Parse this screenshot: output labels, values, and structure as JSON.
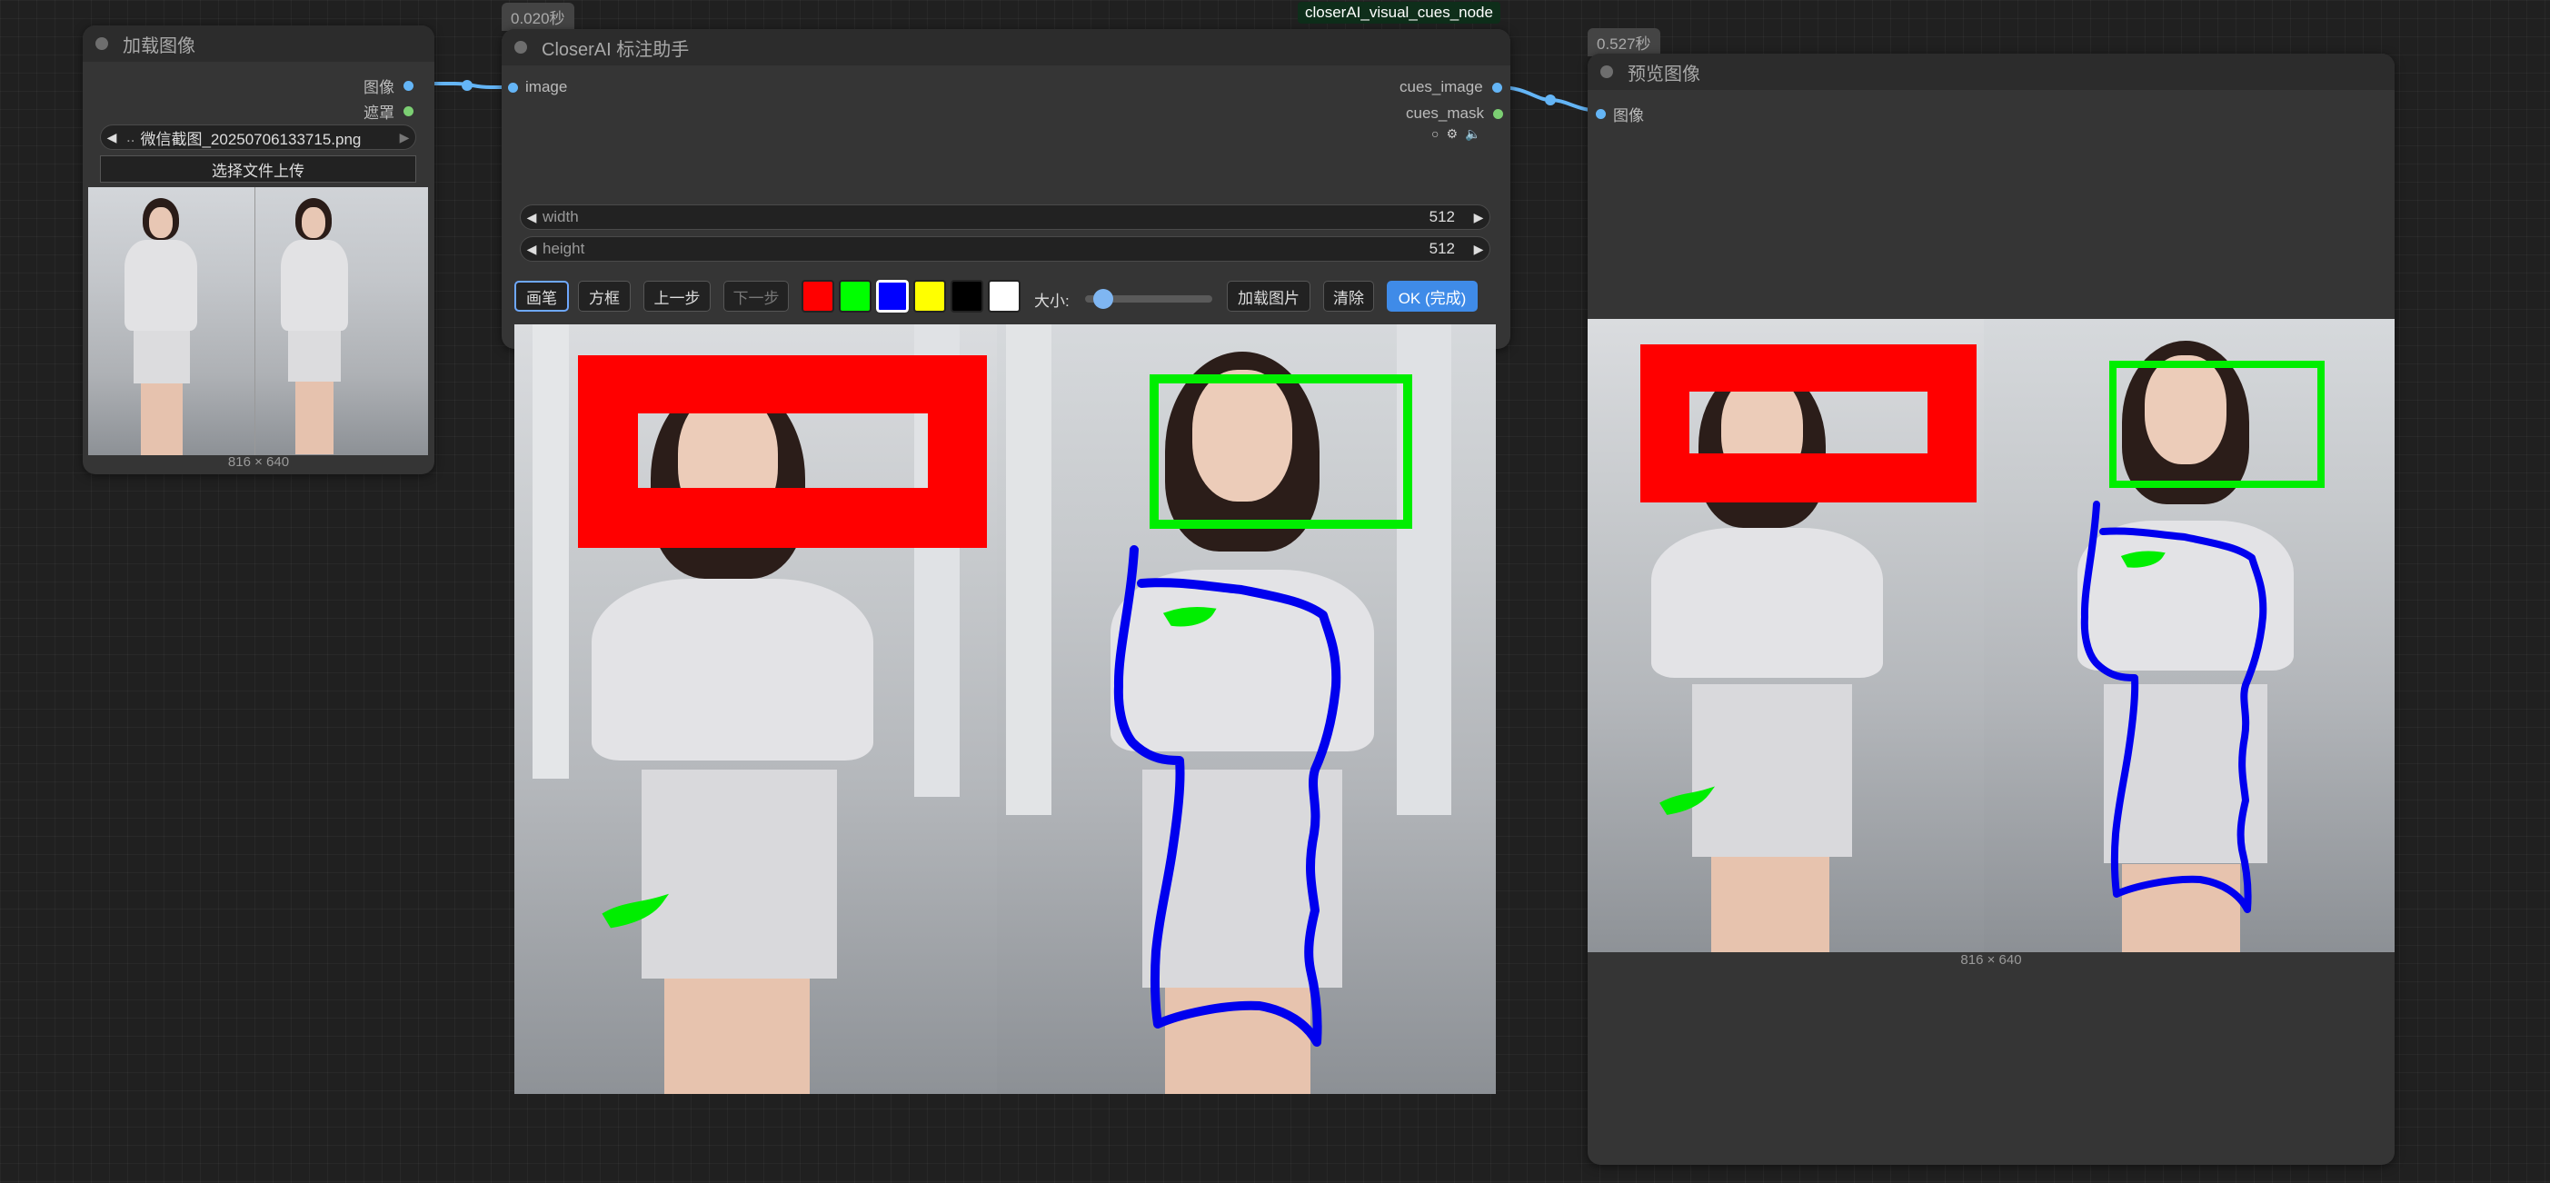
{
  "load_node": {
    "title": "加载图像",
    "outputs": [
      "图像",
      "遮罩"
    ],
    "file_value": "微信截图_20250706133715.png",
    "file_prefix": "..",
    "upload_label": "选择文件上传",
    "dims": "816 × 640"
  },
  "closer_node": {
    "timing": "0.020秒",
    "badge": "closerAI_visual_cues_node",
    "title": "CloserAI 标注助手",
    "input": "image",
    "outputs": [
      "cues_image",
      "cues_mask"
    ],
    "width_label": "width",
    "width_value": "512",
    "height_label": "height",
    "height_value": "512",
    "toolbar": {
      "brush": "画笔",
      "rect": "方框",
      "undo": "上一步",
      "redo": "下一步",
      "size_label": "大小:",
      "size_value": 0.1,
      "load": "加载图片",
      "clear": "清除",
      "ok": "OK (完成)"
    },
    "colors": [
      "#ff0000",
      "#00ff00",
      "#0000ff",
      "#ffff00",
      "#000000",
      "#ffffff"
    ],
    "selected_color": "#0000ff"
  },
  "preview_node": {
    "timing": "0.527秒",
    "title": "预览图像",
    "input": "图像",
    "dims": "816 × 640"
  },
  "theme": {
    "link_color": "#64b5f6",
    "red_mark": "#ff0000",
    "green_mark": "#00ee00",
    "blue_mark": "#0000ee"
  }
}
